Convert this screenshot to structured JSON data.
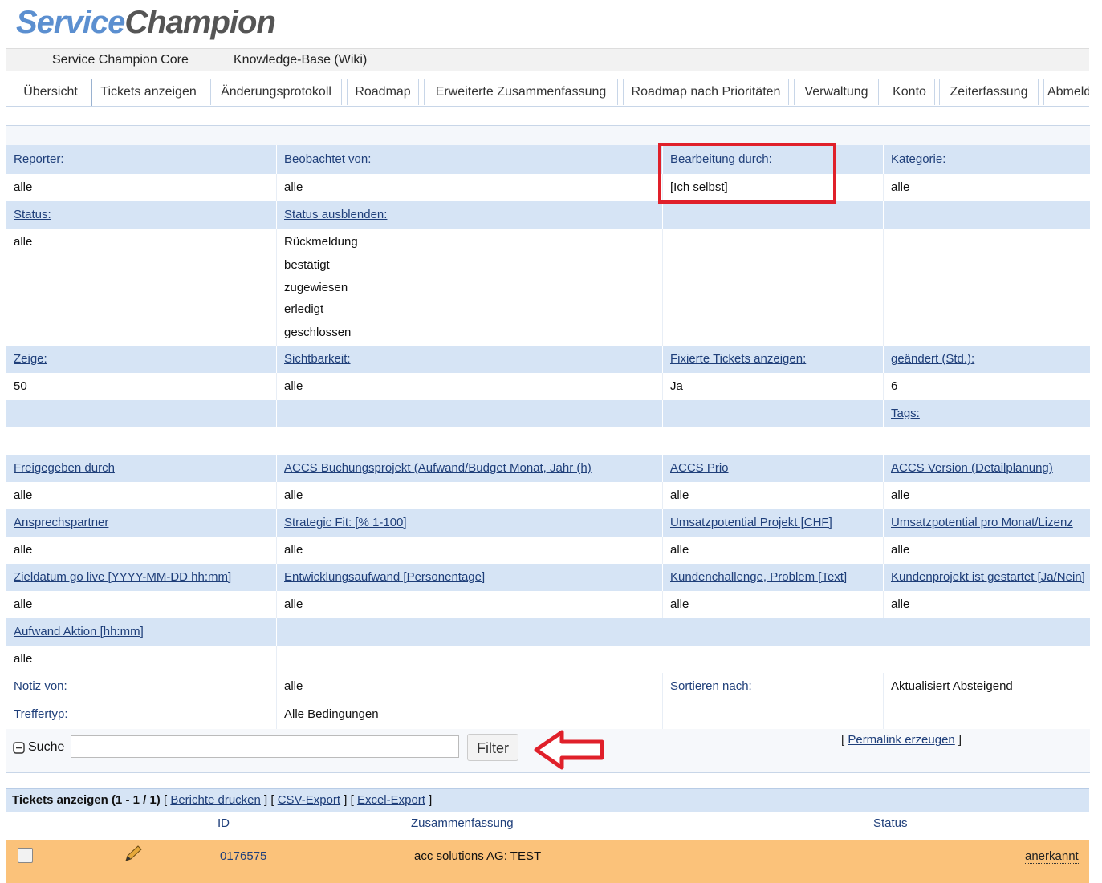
{
  "logo": {
    "part1": "Service",
    "part2": "Champion"
  },
  "projects": [
    "Service Champion Core",
    "Knowledge-Base (Wiki)"
  ],
  "tabs": [
    "Übersicht",
    "Tickets anzeigen",
    "Änderungsprotokoll",
    "Roadmap",
    "Erweiterte Zusammenfassung",
    "Roadmap nach Prioritäten",
    "Verwaltung",
    "Konto",
    "Zeiterfassung",
    "Abmelden"
  ],
  "filters": {
    "row1": {
      "labels": [
        "Reporter:",
        "Beobachtet von:",
        "Bearbeitung durch:",
        "Kategorie:"
      ],
      "values": [
        "alle",
        "alle",
        "[Ich selbst]",
        "alle"
      ]
    },
    "row2": {
      "labels": [
        "Status:",
        "Status ausblenden:"
      ],
      "status_value": "alle",
      "hide_status": [
        "Rückmeldung",
        "bestätigt",
        "zugewiesen",
        "erledigt",
        "geschlossen"
      ]
    },
    "row3": {
      "labels": [
        "Zeige:",
        "Sichtbarkeit:",
        "Fixierte Tickets anzeigen:",
        "geändert (Std.):"
      ],
      "values": [
        "50",
        "alle",
        "Ja",
        "6"
      ]
    },
    "tags_label": "Tags:",
    "row4": {
      "labels": [
        "Freigegeben durch",
        "ACCS Buchungsprojekt (Aufwand/Budget Monat, Jahr (h)",
        "ACCS Prio",
        "ACCS Version (Detailplanung)"
      ],
      "values": [
        "alle",
        "alle",
        "alle",
        "alle"
      ]
    },
    "row5": {
      "labels": [
        "Ansprechspartner",
        "Strategic Fit: [% 1-100]",
        "Umsatzpotential Projekt [CHF]",
        "Umsatzpotential pro Monat/Lizenz"
      ],
      "values": [
        "alle",
        "alle",
        "alle",
        "alle"
      ]
    },
    "row6": {
      "labels": [
        "Zieldatum go live [YYYY-MM-DD hh:mm]",
        "Entwicklungsaufwand [Personentage]",
        "Kundenchallenge, Problem [Text]",
        "Kundenprojekt ist gestartet [Ja/Nein]"
      ],
      "values": [
        "alle",
        "alle",
        "alle",
        "alle"
      ]
    },
    "row7": {
      "label": "Aufwand Aktion [hh:mm]",
      "value": "alle"
    },
    "note": {
      "label": "Notiz von:",
      "value": "alle",
      "sort_label": "Sortieren nach:",
      "sort_value": "Aktualisiert Absteigend"
    },
    "match": {
      "label": "Treffertyp:",
      "value": "Alle Bedingungen"
    }
  },
  "search": {
    "label": "Suche",
    "value": "",
    "button": "Filter",
    "permalink": "Permalink erzeugen"
  },
  "results": {
    "title": "Tickets anzeigen (1 - 1 / 1)",
    "links": [
      "Berichte drucken",
      "CSV-Export",
      "Excel-Export"
    ],
    "columns": [
      "ID",
      "Zusammenfassung",
      "Status"
    ],
    "rows": [
      {
        "id": "0176575",
        "summary": "acc solutions AG: TEST",
        "status": "anerkannt"
      }
    ]
  },
  "colors": {
    "header": "#d6e4f5",
    "highlight": "#fbc27a",
    "annotation": "#e0202a"
  }
}
